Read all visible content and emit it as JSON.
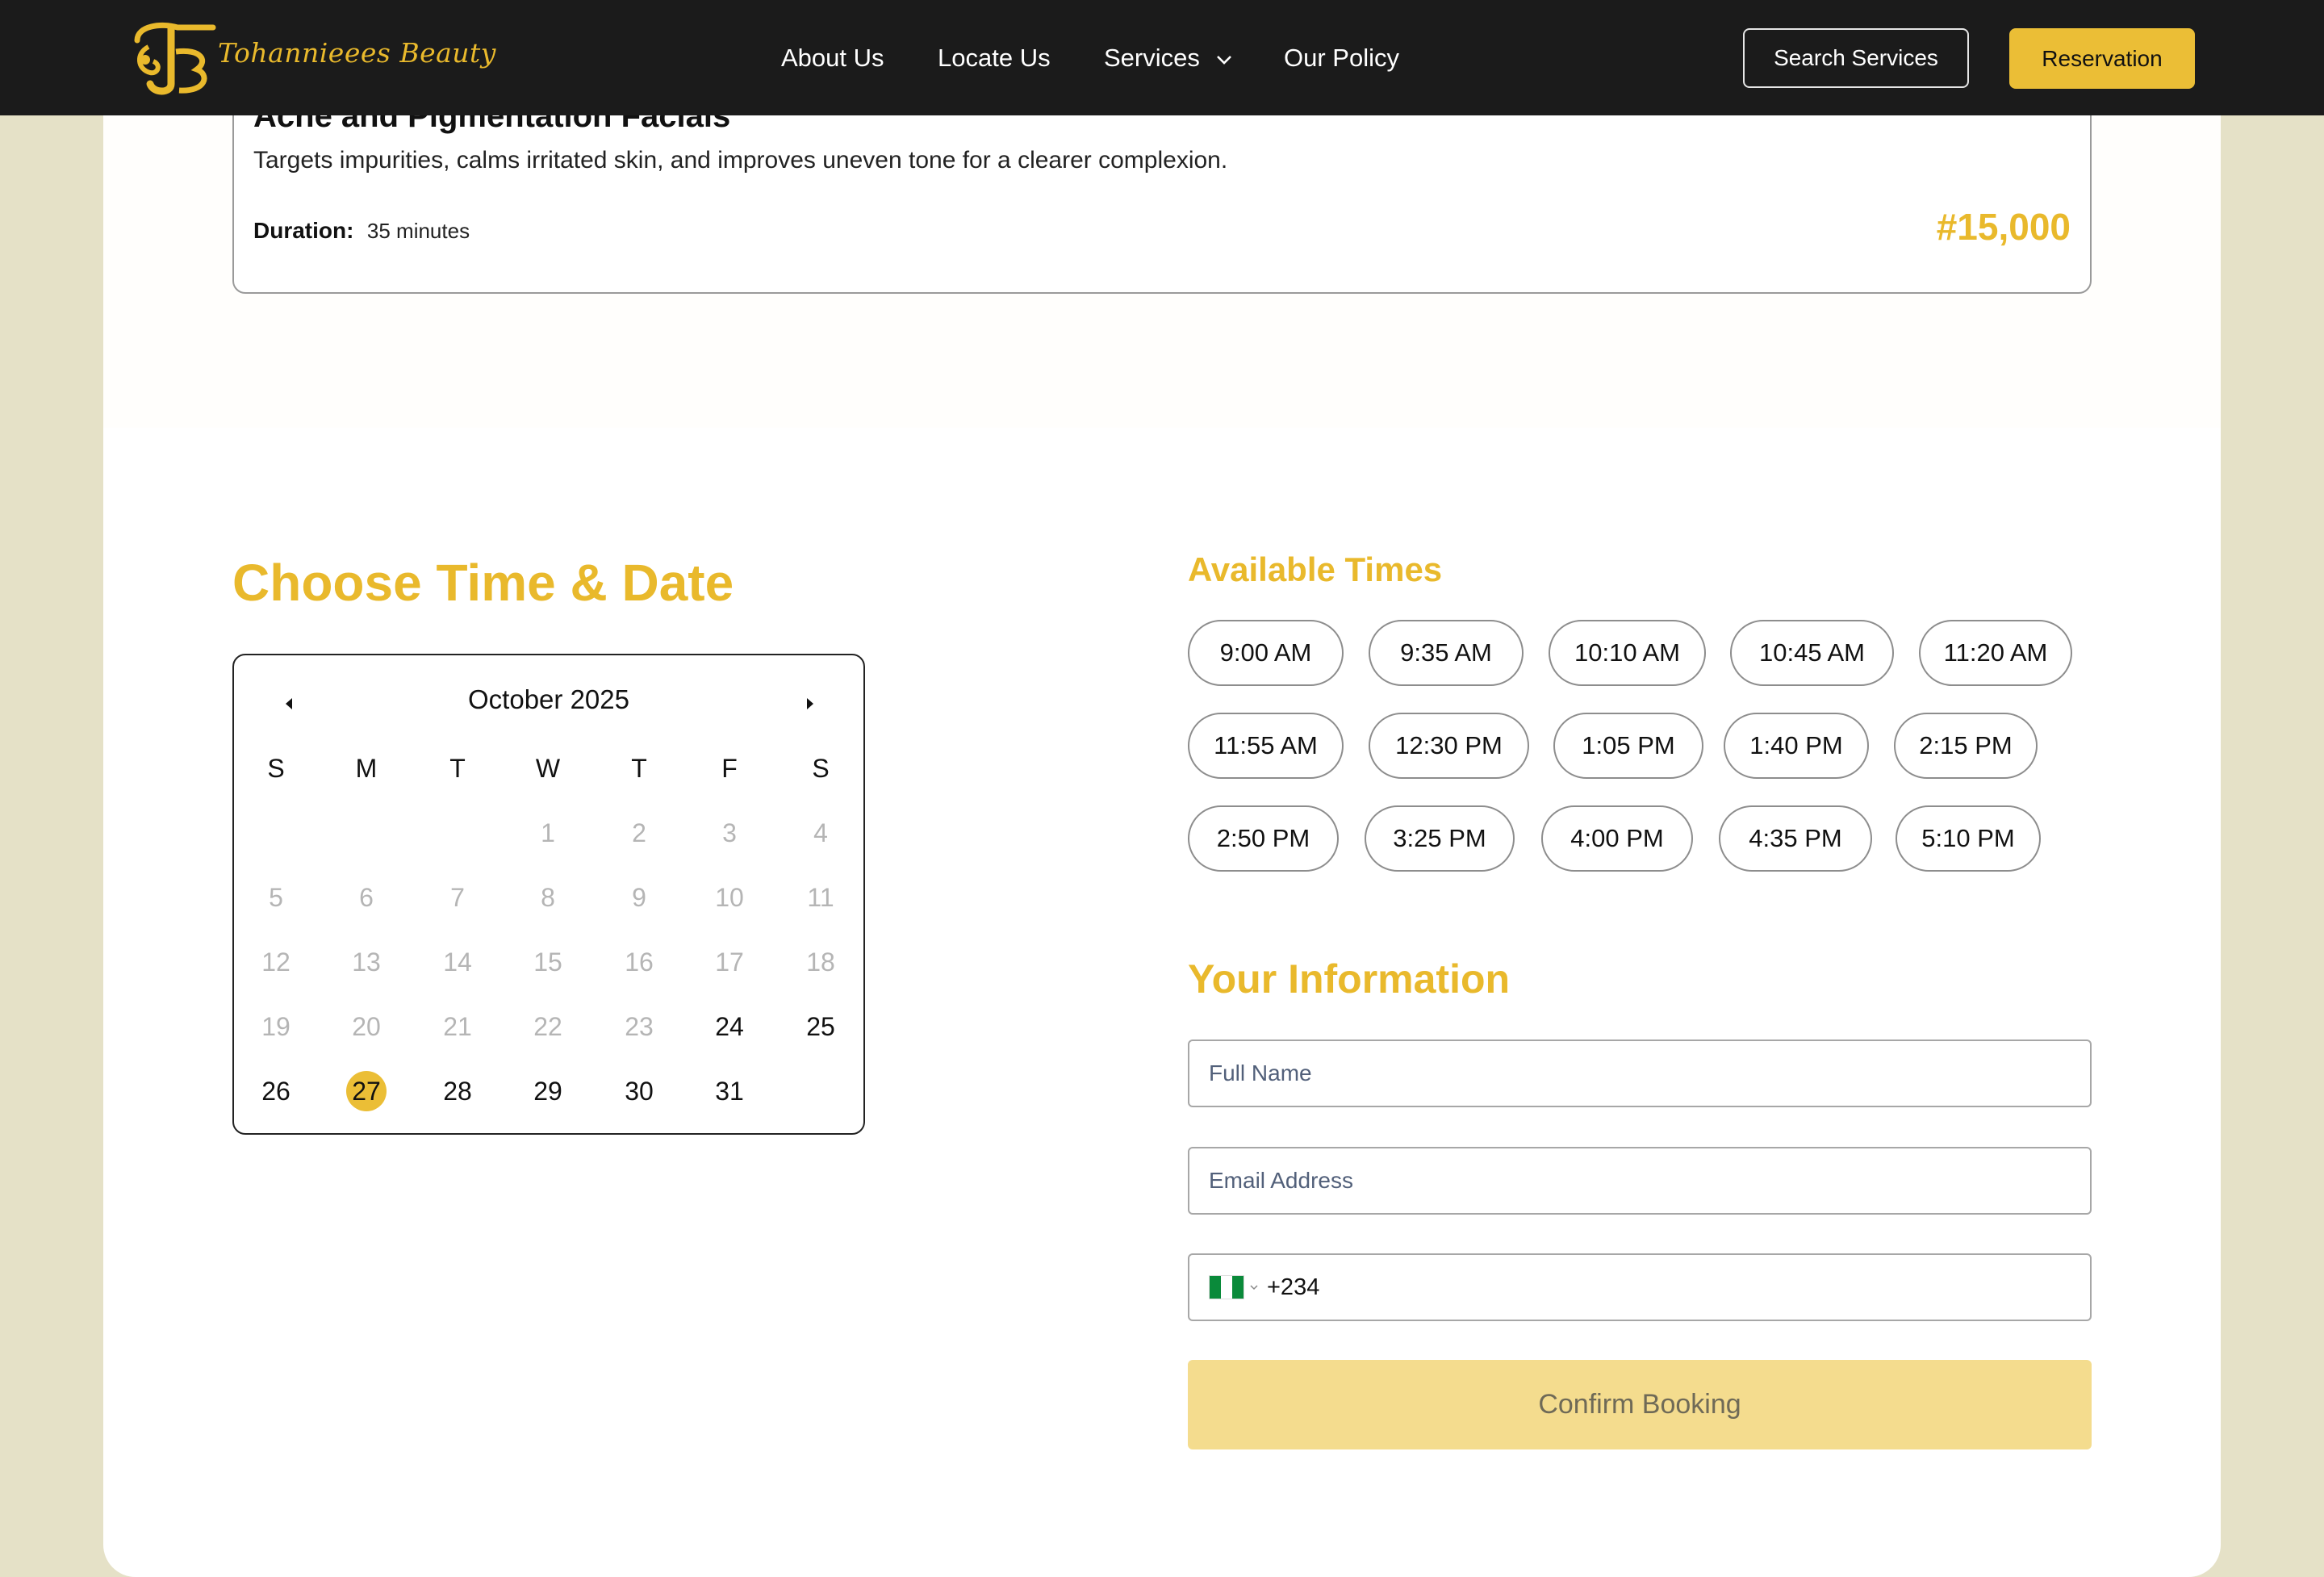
{
  "brand": {
    "name": "Tohannieees Beauty",
    "accent": "#E9B92C"
  },
  "nav": {
    "items": [
      {
        "label": "About Us"
      },
      {
        "label": "Locate Us"
      },
      {
        "label": "Services",
        "has_dropdown": true
      },
      {
        "label": "Our Policy"
      }
    ],
    "search_label": "Search Services",
    "reservation_label": "Reservation"
  },
  "service": {
    "title": "Acne and Pigmentation Facials",
    "description": "Targets impurities, calms irritated skin, and improves uneven tone for a clearer complexion.",
    "duration_label": "Duration:",
    "duration_value": "35 minutes",
    "price": "#15,000"
  },
  "date_section": {
    "title": "Choose Time & Date"
  },
  "calendar": {
    "month_label": "October 2025",
    "weekdays": [
      "S",
      "M",
      "T",
      "W",
      "T",
      "F",
      "S"
    ],
    "first_weekday_index": 3,
    "days_in_month": 31,
    "first_available_day": 24,
    "selected_day": 27
  },
  "times": {
    "title": "Available Times",
    "slots": [
      "9:00 AM",
      "9:35 AM",
      "10:10 AM",
      "10:45 AM",
      "11:20 AM",
      "11:55 AM",
      "12:30 PM",
      "1:05 PM",
      "1:40 PM",
      "2:15 PM",
      "2:50 PM",
      "3:25 PM",
      "4:00 PM",
      "4:35 PM",
      "5:10 PM"
    ]
  },
  "info": {
    "title": "Your Information",
    "full_name_placeholder": "Full Name",
    "email_placeholder": "Email Address",
    "phone_country": "Nigeria",
    "phone_code": "+234",
    "confirm_label": "Confirm Booking"
  }
}
